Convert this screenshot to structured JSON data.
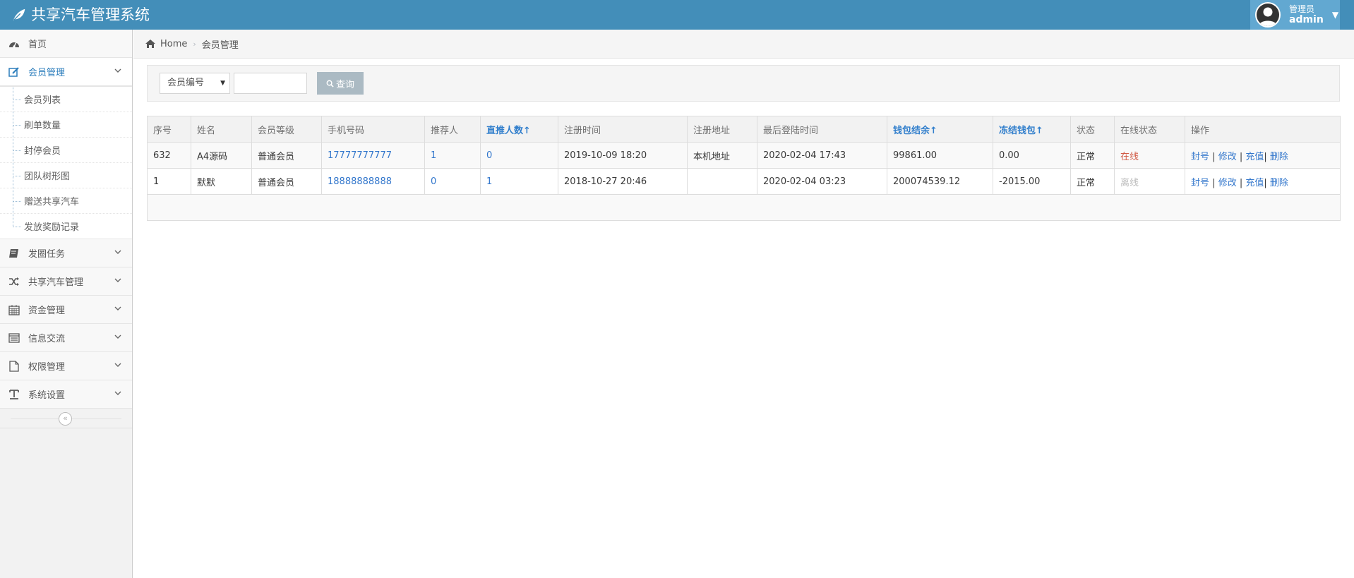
{
  "app": {
    "title": "共享汽车管理系统"
  },
  "user": {
    "role": "管理员",
    "name": "admin"
  },
  "breadcrumb": {
    "home": "Home",
    "current": "会员管理"
  },
  "sidebar": {
    "items": [
      {
        "label": "首页",
        "icon": "dashboard-icon"
      },
      {
        "label": "会员管理",
        "icon": "edit-icon",
        "open": true,
        "children": [
          "会员列表",
          "刷单数量",
          "封停会员",
          "团队树形图",
          "赠送共享汽车",
          "发放奖励记录"
        ]
      },
      {
        "label": "发圈任务",
        "icon": "book-icon"
      },
      {
        "label": "共享汽车管理",
        "icon": "shuffle-icon"
      },
      {
        "label": "资金管理",
        "icon": "calendar-icon"
      },
      {
        "label": "信息交流",
        "icon": "list-icon"
      },
      {
        "label": "权限管理",
        "icon": "file-icon"
      },
      {
        "label": "系统设置",
        "icon": "text-icon"
      }
    ],
    "collapse_glyph": "«"
  },
  "search": {
    "select_value": "会员编号",
    "input_value": "",
    "button_label": "查询"
  },
  "table": {
    "headers": [
      "序号",
      "姓名",
      "会员等级",
      "手机号码",
      "推荐人",
      "直推人数↑",
      "注册时间",
      "注册地址",
      "最后登陆时间",
      "钱包结余↑",
      "冻结钱包↑",
      "状态",
      "在线状态",
      "操作"
    ],
    "rows": [
      {
        "id": "632",
        "name": "A4源码",
        "level": "普通会员",
        "phone": "17777777777",
        "referrer": "1",
        "direct": "0",
        "reg_time": "2019-10-09 18:20",
        "reg_addr": "本机地址",
        "last_login": "2020-02-04 17:43",
        "wallet": "99861.00",
        "frozen": "0.00",
        "status": "正常",
        "online": "在线"
      },
      {
        "id": "1",
        "name": "默默",
        "level": "普通会员",
        "phone": "18888888888",
        "referrer": "0",
        "direct": "1",
        "reg_time": "2018-10-27 20:46",
        "reg_addr": "",
        "last_login": "2020-02-04 03:23",
        "wallet": "200074539.12",
        "frozen": "-2015.00",
        "status": "正常",
        "online": "离线"
      }
    ],
    "actions": {
      "ban": "封号",
      "edit": "修改",
      "recharge": "充值",
      "delete": "删除",
      "sep": "|"
    }
  },
  "colors": {
    "navbar": "#438EB9",
    "link": "#3377CC",
    "online": "#D15B47",
    "offline": "#BBBBBB"
  }
}
